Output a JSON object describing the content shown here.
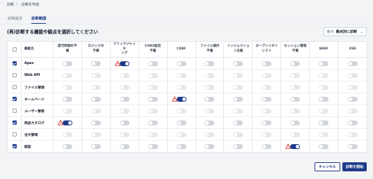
{
  "breadcrumb": {
    "root": "診断",
    "sep": "〉",
    "current": "診断を作成"
  },
  "tabs": [
    {
      "label": "診断設定",
      "active": false
    },
    {
      "label": "診断範囲",
      "active": true
    }
  ],
  "instruction": "(再)診断する機能や観点を選択してください",
  "sort": {
    "label": "観点",
    "value": "観点別に診断",
    "chevron": "⌄"
  },
  "table": {
    "name_header": "機能名",
    "columns": [
      [
        "認可制御の不",
        "備"
      ],
      [
        "ロジックの",
        "不備"
      ],
      [
        "クリックジャッキ",
        "ング"
      ],
      [
        "CORS設定",
        "不備"
      ],
      [
        "CSRF"
      ],
      [
        "ファイル操作",
        "不備"
      ],
      [
        "インジェクショ",
        "ン全般"
      ],
      [
        "オープンリダイ",
        "レクト"
      ],
      [
        "セッション管理",
        "不備"
      ],
      [
        "SSRF"
      ],
      [
        "XSS"
      ]
    ],
    "rows": [
      {
        "name": "Apex",
        "checked": true,
        "toggles": [
          "off",
          "off",
          "on",
          "off",
          "off",
          "off",
          "off",
          "off",
          "off",
          "off",
          "off"
        ],
        "warn": [
          2
        ]
      },
      {
        "name": "Web API",
        "checked": false,
        "toggles": [
          "dis",
          "dis",
          "dis",
          "dis",
          "dis",
          "dis",
          "dis",
          "dis",
          "dis",
          "dis",
          "dis"
        ],
        "warn": []
      },
      {
        "name": "ファイル管理",
        "checked": false,
        "toggles": [
          "dis",
          "dis",
          "dis",
          "dis",
          "dis",
          "dis",
          "dis",
          "dis",
          "dis",
          "dis",
          "dis"
        ],
        "warn": []
      },
      {
        "name": "ホームページ",
        "checked": true,
        "toggles": [
          "off",
          "off",
          "off",
          "off",
          "on",
          "off",
          "off",
          "off",
          "off",
          "off",
          "off"
        ],
        "warn": [
          4
        ]
      },
      {
        "name": "ユーザー管理",
        "checked": false,
        "toggles": [
          "dis",
          "dis",
          "dis",
          "dis",
          "dis",
          "dis",
          "dis",
          "dis",
          "dis",
          "dis",
          "dis"
        ],
        "warn": []
      },
      {
        "name": "商品カタログ",
        "checked": true,
        "toggles": [
          "on",
          "off",
          "off",
          "off",
          "off",
          "off",
          "off",
          "off",
          "off",
          "off",
          "off"
        ],
        "warn": [
          0
        ]
      },
      {
        "name": "注文管理",
        "checked": false,
        "toggles": [
          "dis",
          "dis",
          "dis",
          "dis",
          "dis",
          "dis",
          "dis",
          "dis",
          "dis",
          "dis",
          "dis"
        ],
        "warn": []
      },
      {
        "name": "認証",
        "checked": true,
        "toggles": [
          "off",
          "off",
          "off",
          "off",
          "off",
          "off",
          "off",
          "off",
          "on",
          "off",
          "off"
        ],
        "warn": [
          8
        ]
      }
    ]
  },
  "buttons": {
    "cancel": "キャンセル",
    "start": "診断を開始"
  },
  "colors": {
    "accent": "#1e3a8a",
    "warning": "#dc2626",
    "toggle_off": "#d1d5db"
  }
}
